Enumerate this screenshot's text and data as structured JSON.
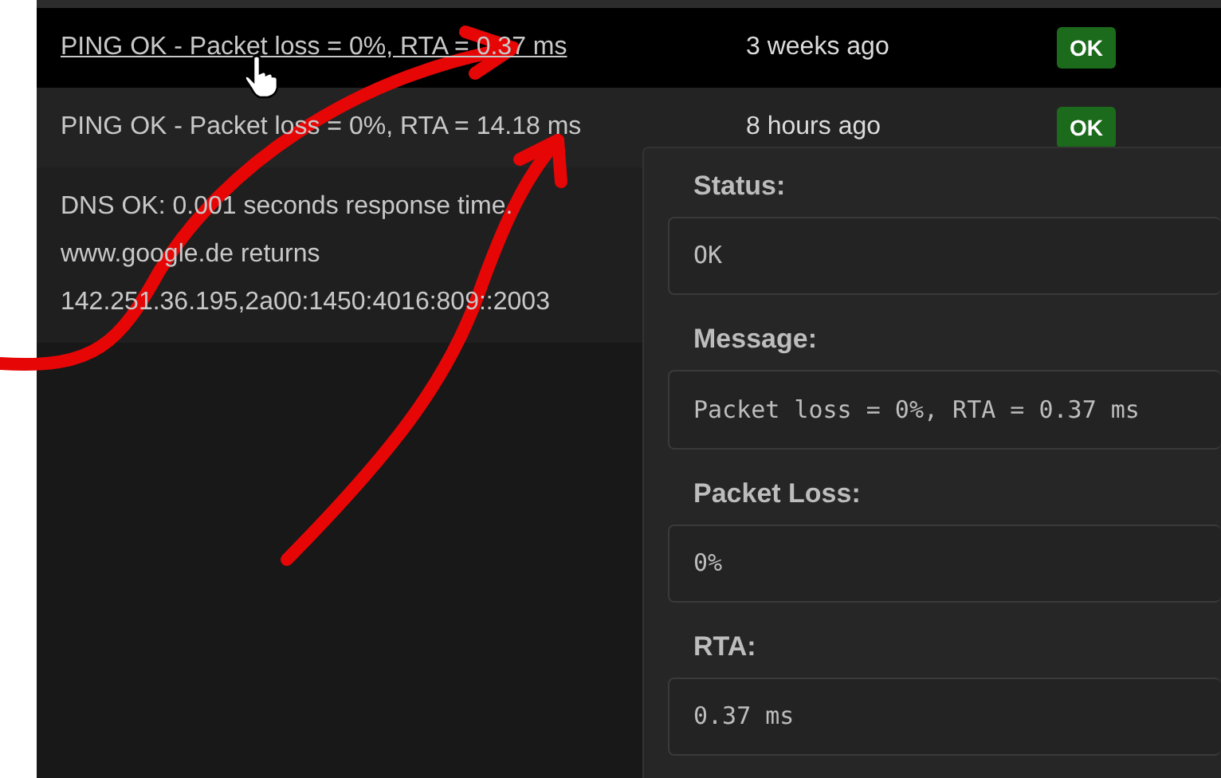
{
  "rows": [
    {
      "message_lines": [
        "PING OK - Packet loss = 0%, RTA = 0.37 ms"
      ],
      "time": "3 weeks ago",
      "status": "OK",
      "hovered": true
    },
    {
      "message_lines": [
        "PING OK - Packet loss = 0%, RTA = 14.18 ms"
      ],
      "time": "8 hours ago",
      "status": "OK",
      "hovered": false
    },
    {
      "message_lines": [
        "DNS OK: 0.001 seconds response time.",
        "www.google.de returns",
        "142.251.36.195,2a00:1450:4016:809::2003"
      ],
      "hovered": false
    }
  ],
  "tooltip": {
    "fields": [
      {
        "label": "Status:",
        "value": "OK"
      },
      {
        "label": "Message:",
        "value": "Packet loss = 0%, RTA = 0.37 ms"
      },
      {
        "label": "Packet Loss:",
        "value": "0%"
      },
      {
        "label": "RTA:",
        "value": "0.37 ms"
      }
    ]
  }
}
